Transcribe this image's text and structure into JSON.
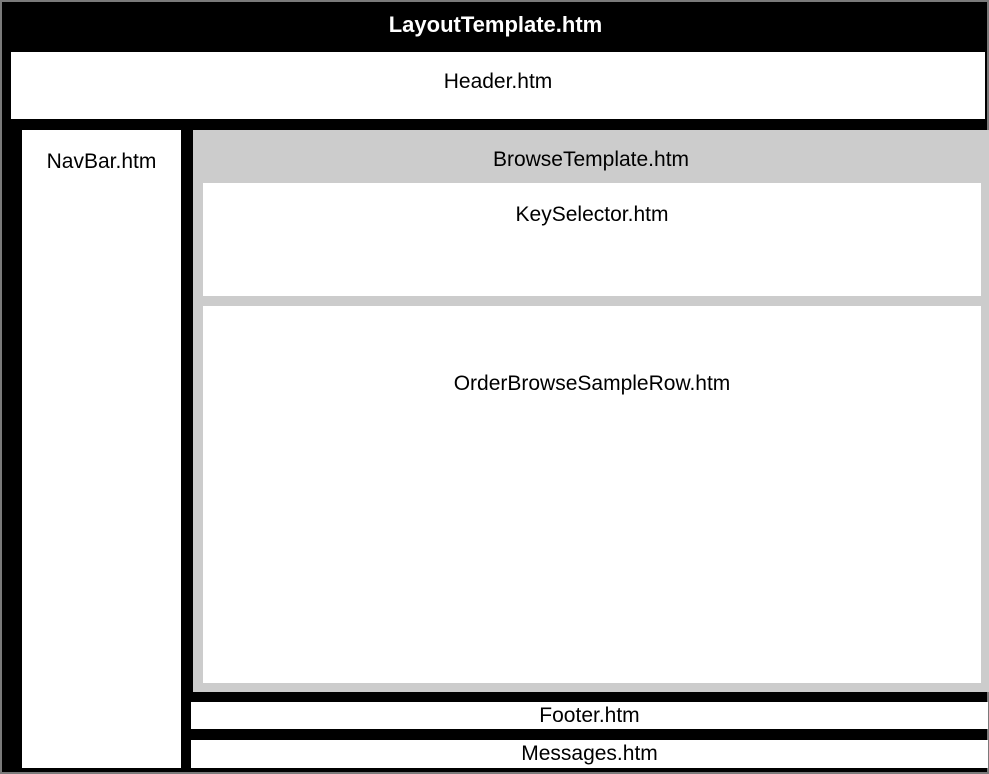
{
  "layout_template": "LayoutTemplate.htm",
  "header": "Header.htm",
  "navbar": "NavBar.htm",
  "browse_template": "BrowseTemplate.htm",
  "key_selector": "KeySelector.htm",
  "order_row": "OrderBrowseSampleRow.htm",
  "footer": "Footer.htm",
  "messages": "Messages.htm",
  "colors": {
    "outer": "#000000",
    "browse_background": "#cccccc",
    "panel": "#ffffff"
  }
}
